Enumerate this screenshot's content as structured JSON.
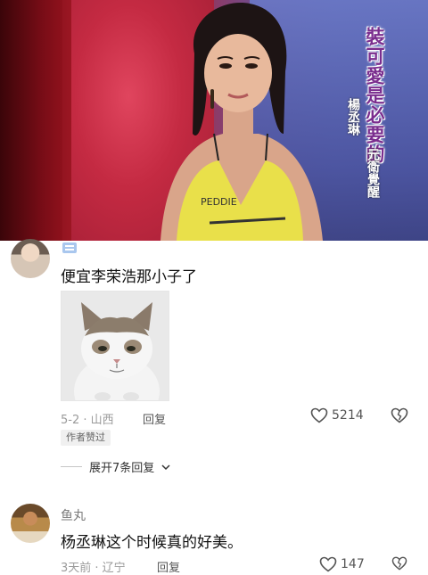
{
  "video": {
    "caption": "裝可愛是必要的",
    "credit_name": "楊丞琳",
    "credit_role": "元衛覺醒"
  },
  "comments": [
    {
      "text": "便宜李荣浩那小子了",
      "meta": "5-2 · 山西",
      "reply_label": "回复",
      "likes": "5214",
      "badge": "作者赞过",
      "expand_label": "展开7条回复"
    },
    {
      "username": "鱼丸",
      "text": "杨丞琳这个时候真的好美。",
      "meta": "3天前 · 辽宁",
      "reply_label": "回复",
      "likes": "147"
    }
  ],
  "colors": {
    "caption": "#7a2d8e",
    "meta": "#9a9a9a",
    "like_icon": "#555555"
  }
}
